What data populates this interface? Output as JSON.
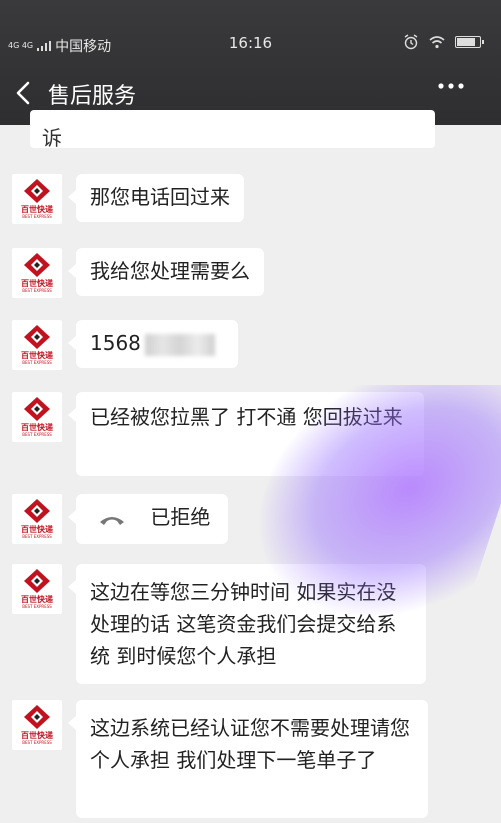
{
  "status_bar": {
    "signal": "4G 4G",
    "carrier": "中国移动",
    "time": "16:16",
    "battery_level": 0.75
  },
  "nav": {
    "title": "售后服务"
  },
  "avatar": {
    "brand": "百世快递",
    "sub": "BEST EXPRESS"
  },
  "messages": [
    {
      "text": "诉"
    },
    {
      "text": "那您电话回过来"
    },
    {
      "text": "我给您处理需要么"
    },
    {
      "text": "1568"
    },
    {
      "text": "已经被您拉黑了 打不通 您回拔过来"
    },
    {
      "text": "已拒绝"
    },
    {
      "text": "这边在等您三分钟时间 如果实在没处理的话 这笔资金我们会提交给系统  到时候您个人承担"
    },
    {
      "text": "这边系统已经认证您不需要处理请您个人承担 我们处理下一笔单子了"
    }
  ],
  "colors": {
    "header": "#3a3a3c",
    "chat_bg": "#efefef",
    "bubble": "#ffffff",
    "brand_red": "#c1121f"
  }
}
